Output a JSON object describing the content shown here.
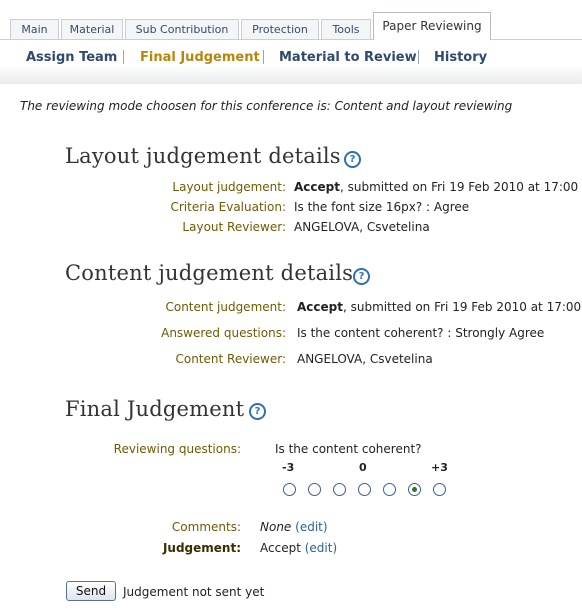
{
  "tabs": [
    "Main",
    "Material",
    "Sub Contribution",
    "Protection",
    "Tools",
    "Paper Reviewing"
  ],
  "subnav": [
    "Assign Team",
    "Final Judgement",
    "Material to Review",
    "History"
  ],
  "mode_note": "The reviewing mode choosen for this conference is: Content and layout reviewing",
  "layout": {
    "title": "Layout judgement details",
    "judgement_label": "Layout judgement:",
    "judgement_value": "Accept",
    "judgement_suffix": ", submitted on Fri 19 Feb 2010 at 17:00",
    "criteria_label": "Criteria Evaluation:",
    "criteria_value": "Is the font size 16px? : Agree",
    "reviewer_label": "Layout Reviewer:",
    "reviewer_value": "ANGELOVA, Csvetelina"
  },
  "content": {
    "title": "Content judgement details",
    "judgement_label": "Content judgement:",
    "judgement_value": "Accept",
    "judgement_suffix": ", submitted on Fri 19 Feb 2010 at 17:00",
    "answered_label": "Answered questions:",
    "answered_value": "Is the content coherent? : Strongly Agree",
    "reviewer_label": "Content Reviewer:",
    "reviewer_value": "ANGELOVA, Csvetelina"
  },
  "final": {
    "title": "Final Judgement",
    "questions_label": "Reviewing questions:",
    "question": "Is the content coherent?",
    "scale_low": "-3",
    "scale_mid": "0",
    "scale_high": "+3",
    "selected_index": 5,
    "comments_label": "Comments:",
    "comments_value": "None",
    "judgement_label": "Judgement:",
    "judgement_value": "Accept",
    "edit_label": "(edit)"
  },
  "send_label": "Send",
  "send_status": "Judgement not sent yet",
  "help_glyph": "?"
}
